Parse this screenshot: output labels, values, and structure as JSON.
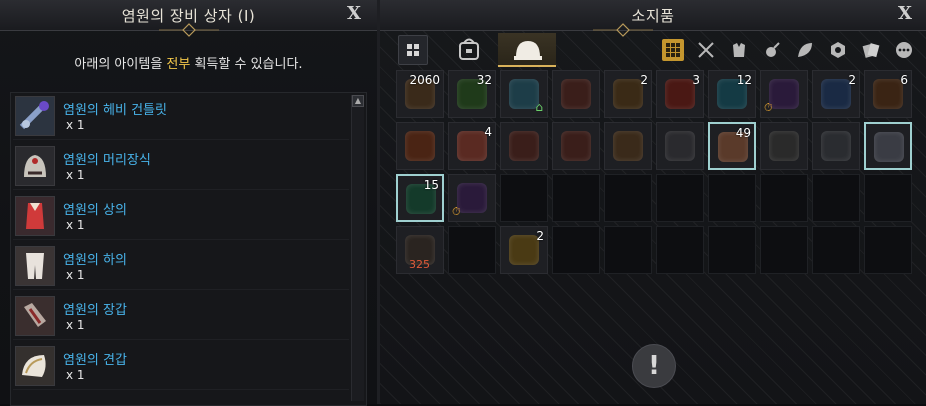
{
  "left_panel": {
    "title": "염원의 장비 상자 (I)",
    "close_label": "X",
    "instruction_prefix": "아래의 아이템을 ",
    "instruction_highlight": "전부",
    "instruction_suffix": " 획득할 수 있습니다.",
    "items": [
      {
        "name": "염원의 헤비 건틀릿",
        "qty": "x 1",
        "icon": "gauntlet-weapon-icon"
      },
      {
        "name": "염원의 머리장식",
        "qty": "x 1",
        "icon": "headgear-icon"
      },
      {
        "name": "염원의 상의",
        "qty": "x 1",
        "icon": "top-armor-icon"
      },
      {
        "name": "염원의 하의",
        "qty": "x 1",
        "icon": "bottom-armor-icon"
      },
      {
        "name": "염원의 장갑",
        "qty": "x 1",
        "icon": "gloves-icon"
      },
      {
        "name": "염원의 견갑",
        "qty": "x 1",
        "icon": "shoulder-armor-icon"
      }
    ]
  },
  "right_panel": {
    "title": "소지품",
    "close_label": "X",
    "tabs": [
      "grid-view-icon",
      "bag-icon",
      "helmet-icon"
    ],
    "filters": [
      "all-icon",
      "sword-icon",
      "armor-icon",
      "potion-icon",
      "leaf-icon",
      "gem-icon",
      "cards-icon",
      "more-icon"
    ],
    "slots_row1": [
      {
        "count": "2060",
        "color": "#3a2a1a"
      },
      {
        "count": "32",
        "color": "#1f3a1a"
      },
      {
        "count": "",
        "color": "#1d3d48",
        "home": true
      },
      {
        "count": "",
        "color": "#3a1e1a"
      },
      {
        "count": "2",
        "color": "#3a2a16"
      },
      {
        "count": "3",
        "color": "#4a1814"
      },
      {
        "count": "12",
        "color": "#143a44"
      },
      {
        "count": "",
        "color": "#2a1a3a",
        "timer": true
      },
      {
        "count": "2",
        "color": "#1a2a44"
      },
      {
        "count": "6",
        "color": "#3a2414"
      }
    ],
    "slots_row2": [
      {
        "count": "",
        "color": "#4a2414"
      },
      {
        "count": "4",
        "color": "#5a2a22"
      },
      {
        "count": "",
        "color": "#3a1e1a"
      },
      {
        "count": "",
        "color": "#3a1e1a"
      },
      {
        "count": "",
        "color": "#3a2a1a"
      },
      {
        "count": "",
        "color": "#2a2a2e"
      },
      {
        "count": "49",
        "color": "#5a3a2a",
        "selected": true
      },
      {
        "count": "",
        "color": "#2a2a2a"
      },
      {
        "count": "",
        "color": "#2a2c30"
      },
      {
        "count": "",
        "color": "#3a3c44",
        "selected": true
      }
    ],
    "slots_row3": [
      {
        "count": "15",
        "color": "#143a2a",
        "selected": true
      },
      {
        "count": "",
        "color": "#2a1a3a",
        "timer": true
      }
    ],
    "slots_row4": [
      {
        "count": "",
        "color": "#2a2420",
        "red": "325"
      },
      {
        "count": "",
        "color": ""
      },
      {
        "count": "2",
        "color": "#4a3a14"
      }
    ],
    "warning_icon": "!"
  }
}
